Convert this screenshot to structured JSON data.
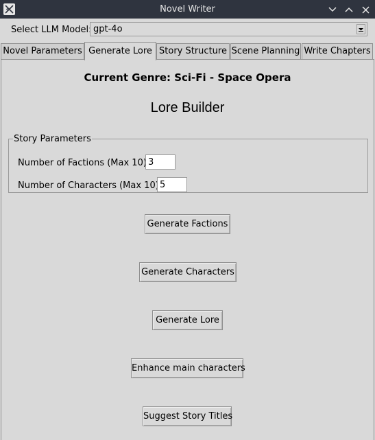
{
  "window": {
    "title": "Novel Writer"
  },
  "model": {
    "label": "Select LLM Model:",
    "value": "gpt-4o"
  },
  "tabs": [
    {
      "label": "Novel Parameters"
    },
    {
      "label": "Generate Lore"
    },
    {
      "label": "Story Structure"
    },
    {
      "label": "Scene Planning"
    },
    {
      "label": "Write Chapters"
    }
  ],
  "active_tab": "Generate Lore",
  "main": {
    "genre": "Current Genre: Sci-Fi - Space Opera",
    "heading": "Lore Builder",
    "params": {
      "legend": "Story Parameters",
      "factions_label": "Number of Factions (Max 10):",
      "factions_value": "3",
      "characters_label": "Number of Characters (Max 10):",
      "characters_value": "5"
    },
    "buttons": {
      "factions": "Generate Factions",
      "characters": "Generate Characters",
      "lore": "Generate Lore",
      "enhance": "Enhance main characters",
      "titles": "Suggest Story Titles"
    }
  }
}
